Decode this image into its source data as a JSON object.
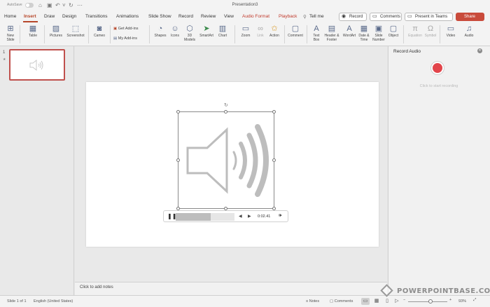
{
  "title_bar": {
    "autosave_label": "AutoSave",
    "document_title": "Presentation3",
    "quick_icons": [
      "home-icon",
      "save-icon",
      "print-icon",
      "undo-icon",
      "redo-icon",
      "more-icon"
    ]
  },
  "tabs": [
    {
      "label": "Home",
      "active": false
    },
    {
      "label": "Insert",
      "active": true
    },
    {
      "label": "Draw",
      "active": false
    },
    {
      "label": "Design",
      "active": false
    },
    {
      "label": "Transitions",
      "active": false
    },
    {
      "label": "Animations",
      "active": false
    },
    {
      "label": "Slide Show",
      "active": false
    },
    {
      "label": "Record",
      "active": false
    },
    {
      "label": "Review",
      "active": false
    },
    {
      "label": "View",
      "active": false
    },
    {
      "label": "Audio Format",
      "active": false,
      "contextual": true
    },
    {
      "label": "Playback",
      "active": false,
      "contextual": true
    }
  ],
  "tell_me": "Tell me",
  "right_actions": {
    "record": "Record",
    "comments": "Comments",
    "present_teams": "Present in Teams",
    "share": "Share"
  },
  "ribbon": {
    "new_slide": "New\nSlide",
    "table": "Table",
    "pictures": "Pictures",
    "screenshot": "Screenshot",
    "cameo": "Cameo",
    "get_addins": "Get Add-ins",
    "my_addins": "My Add-ins",
    "shapes": "Shapes",
    "icons": "Icons",
    "models_3d": "3D\nModels",
    "smartart": "SmartArt",
    "chart": "Chart",
    "zoom": "Zoom",
    "link": "Link",
    "action": "Action",
    "comment": "Comment",
    "text_box": "Text\nBox",
    "header_footer": "Header &\nFooter",
    "wordart": "WordArt",
    "date_time": "Date &\nTime",
    "slide_number": "Slide\nNumber",
    "object": "Object",
    "equation": "Equation",
    "symbol": "Symbol",
    "video": "Video",
    "audio": "Audio"
  },
  "thumbnails": {
    "slide_number": "1",
    "star": "★"
  },
  "audio_player": {
    "time": "0:02.41",
    "progress": 0.6
  },
  "notes_placeholder": "Click to add notes",
  "record_pane": {
    "title": "Record Audio",
    "hint": "Click to start recording"
  },
  "status_bar": {
    "slide_info": "Slide 1 of 1",
    "language": "English (United States)",
    "notes": "Notes",
    "comments": "Comments",
    "zoom": "93%"
  },
  "watermark": "POWERPOINTBASE.COM",
  "colors": {
    "accent": "#b7472a",
    "share": "#c94b3b",
    "record": "#e2454b"
  }
}
